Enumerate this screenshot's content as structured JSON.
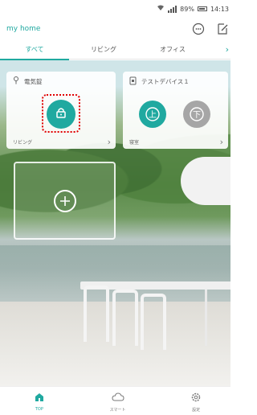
{
  "status": {
    "battery": "89%",
    "time": "14:13"
  },
  "header": {
    "title": "my home"
  },
  "tabs": [
    {
      "label": "すべて"
    },
    {
      "label": "リビング"
    },
    {
      "label": "オフィス"
    }
  ],
  "cards": [
    {
      "name": "電気錠",
      "room": "リビング"
    },
    {
      "name": "テストデバイス１",
      "room": "寝室"
    }
  ],
  "device_btn_labels": {
    "up": "上",
    "down": "下"
  },
  "bottom_nav": [
    {
      "label": "TOP"
    },
    {
      "label": "スマート"
    },
    {
      "label": "設定"
    }
  ],
  "colors": {
    "accent": "#20a9a0",
    "highlight": "#e10000",
    "inactive": "#a6a6a6"
  }
}
